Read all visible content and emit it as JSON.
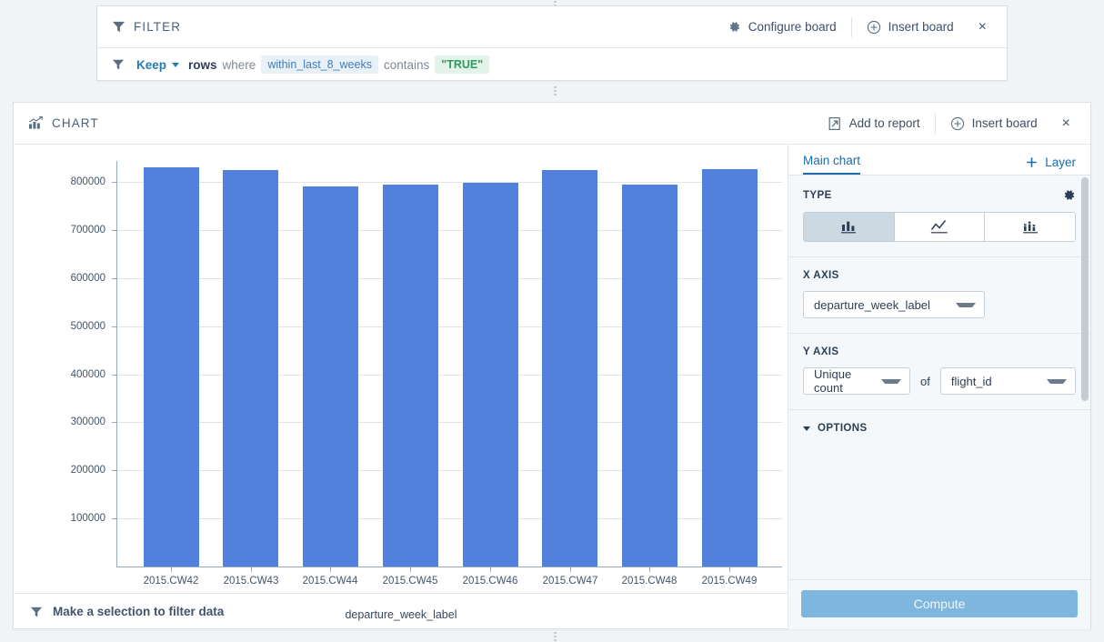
{
  "filter_board": {
    "title": "FILTER",
    "icon": "filter-icon",
    "actions": {
      "configure": "Configure board",
      "insert": "Insert board",
      "close": "×"
    },
    "rule": {
      "mode": "Keep",
      "rows_word": "rows",
      "where_word": "where",
      "column": "within_last_8_weeks",
      "operator": "contains",
      "value": "\"TRUE\""
    }
  },
  "chart_board": {
    "title": "CHART",
    "icon": "chart-icon",
    "actions": {
      "add_to_report": "Add to report",
      "insert": "Insert board",
      "close": "×"
    },
    "bottom_bar": {
      "text": "Make a selection to filter data",
      "icon": "filter-icon"
    }
  },
  "settings": {
    "tab_main": "Main chart",
    "tab_add_layer": "Layer",
    "type_label": "TYPE",
    "type_options": [
      {
        "name": "bar-chart-type",
        "selected": true
      },
      {
        "name": "line-chart-type",
        "selected": false
      },
      {
        "name": "stacked-chart-type",
        "selected": false
      }
    ],
    "x_axis_label": "X AXIS",
    "x_axis_value": "departure_week_label",
    "y_axis_label": "Y AXIS",
    "y_axis_agg": "Unique count",
    "y_axis_of": "of",
    "y_axis_field": "flight_id",
    "options_label": "OPTIONS",
    "compute_label": "Compute"
  },
  "chart_data": {
    "type": "bar",
    "title": "",
    "xlabel": "departure_week_label",
    "ylabel": "",
    "categories": [
      "2015.CW42",
      "2015.CW43",
      "2015.CW44",
      "2015.CW45",
      "2015.CW46",
      "2015.CW47",
      "2015.CW48",
      "2015.CW49"
    ],
    "values": [
      830000,
      824000,
      790000,
      794000,
      799000,
      824000,
      794000,
      826000
    ],
    "series": [
      {
        "name": "Unique count of flight_id",
        "values": [
          830000,
          824000,
          790000,
          794000,
          799000,
          824000,
          794000,
          826000
        ]
      }
    ],
    "ylim": [
      0,
      900000
    ],
    "yticks": [
      100000,
      200000,
      300000,
      400000,
      500000,
      600000,
      700000,
      800000
    ],
    "ytick_labels": [
      "100000",
      "200000",
      "300000",
      "400000",
      "500000",
      "600000",
      "700000",
      "800000"
    ],
    "grid": true,
    "legend": false,
    "bar_color": "#5180dd"
  }
}
